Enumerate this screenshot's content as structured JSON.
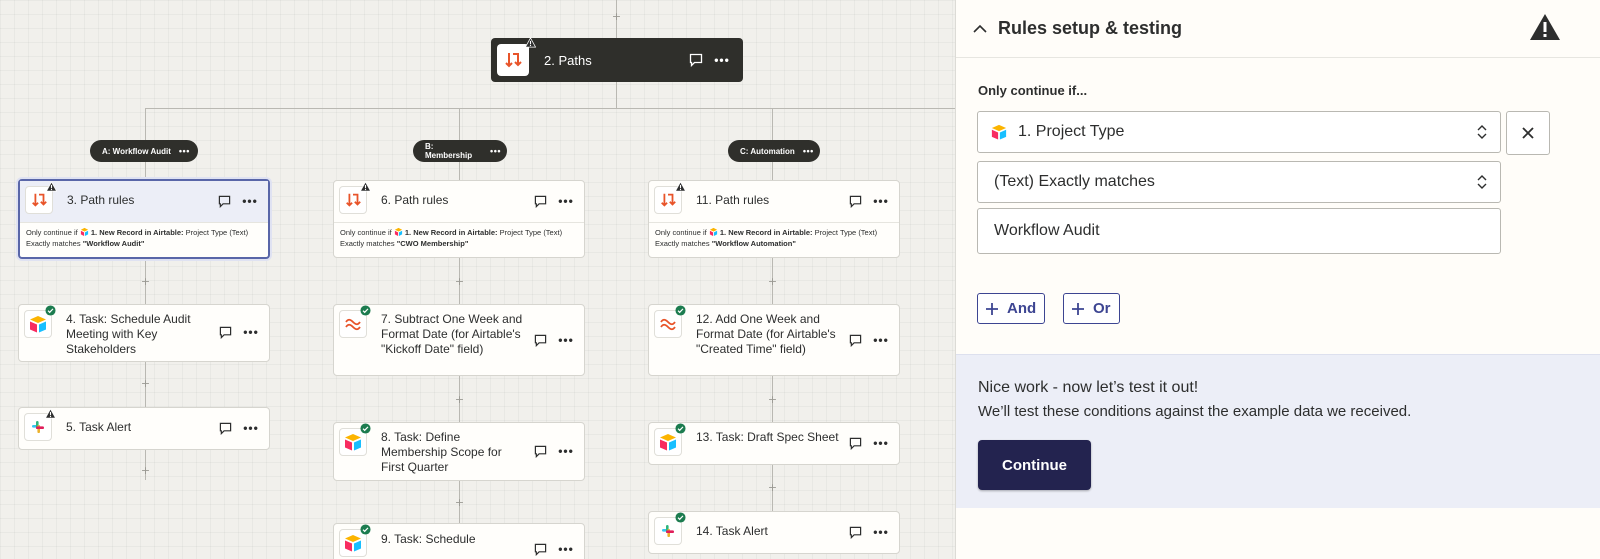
{
  "canvas": {
    "paths_node": {
      "title": "2. Paths"
    },
    "branches": [
      {
        "label": "A: Workflow Audit"
      },
      {
        "label": "B: Membership"
      },
      {
        "label": "C: Automation"
      }
    ],
    "path_rules": [
      {
        "title": "3. Path rules",
        "prefix": "Only continue if",
        "source": "1. New Record in Airtable:",
        "field": "Project Type",
        "type": "(Text)",
        "op": "Exactly matches",
        "value": "\"Workflow Audit\""
      },
      {
        "title": "6. Path rules",
        "prefix": "Only continue if",
        "source": "1. New Record in Airtable:",
        "field": "Project Type",
        "type": "(Text)",
        "op": "Exactly matches",
        "value": "\"CWO Membership\""
      },
      {
        "title": "11. Path rules",
        "prefix": "Only continue if",
        "source": "1. New Record in Airtable:",
        "field": "Project Type",
        "type": "(Text)",
        "op": "Exactly matches",
        "value": "\"Workflow Automation\""
      }
    ],
    "steps": {
      "a1": "4. Task: Schedule Audit Meeting with Key Stakeholders",
      "a2": "5. Task Alert",
      "b1": "7. Subtract One Week and Format Date (for Airtable's \"Kickoff Date\" field)",
      "b2": "8. Task: Define Membership Scope for First Quarter",
      "b3": "9. Task: Schedule",
      "c1": "12. Add One Week and Format Date (for Airtable's \"Created Time\" field)",
      "c2": "13. Task: Draft Spec Sheet",
      "c3": "14. Task Alert"
    }
  },
  "panel": {
    "title": "Rules setup & testing",
    "only_continue": "Only continue if...",
    "field_value": "1. Project Type",
    "condition_value": "(Text) Exactly matches",
    "match_value": "Workflow Audit",
    "and_label": "And",
    "or_label": "Or",
    "test_heading": "Nice work - now let’s test it out!",
    "test_description": "We’ll test these conditions against the example data we received.",
    "continue_label": "Continue"
  },
  "colors": {
    "accent": "#3d4592",
    "continue_bg": "#23234f",
    "paths_orange": "#e8542a",
    "success": "#1c7c4f"
  }
}
